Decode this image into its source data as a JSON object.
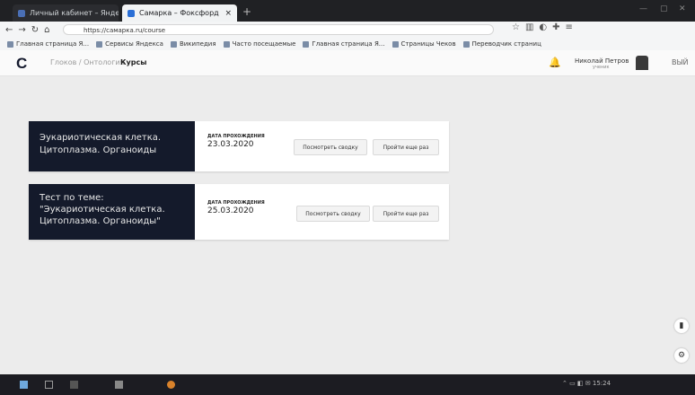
{
  "browser": {
    "tabs": [
      {
        "label": "Личный кабинет – Яндекс",
        "active": false
      },
      {
        "label": "Самарка – Фоксфорд",
        "active": true
      }
    ],
    "url": "https://самарка.ru/course",
    "bookmarks": [
      "Главная страница Я...",
      "Сервисы Яндекса",
      "Википедия",
      "Часто посещаемые",
      "Главная страница Я...",
      "Страницы Чеков",
      "Переводчик страниц"
    ]
  },
  "header": {
    "logo": "C",
    "breadcrumb": "Глоков / Онтология",
    "active_crumb": "Курсы",
    "user_name": "Николай Петров",
    "user_sub": "ученик",
    "logout": "ВЫЙ"
  },
  "tests": [
    {
      "title": "Эукариотическая клетка.\nЦитоплазма. Органоиды",
      "date_label": "ДАТА ПРОХОЖДЕНИЯ",
      "date": "23.03.2020",
      "view_btn": "Посмотреть сводку",
      "retry_btn": "Пройти еще раз"
    },
    {
      "title": "Тест по теме:\n\"Эукариотическая клетка.\nЦитоплазма. Органоиды\"",
      "date_label": "ДАТА ПРОХОЖДЕНИЯ",
      "date": "25.03.2020",
      "view_btn": "Посмотреть сводку",
      "retry_btn": "Пройти еще раз"
    }
  ],
  "taskbar": {
    "clock": "15:24"
  },
  "colors": {
    "card_dark": "#141a2b",
    "page_bg": "#ececec",
    "tab_active": "#f1f3f4"
  }
}
